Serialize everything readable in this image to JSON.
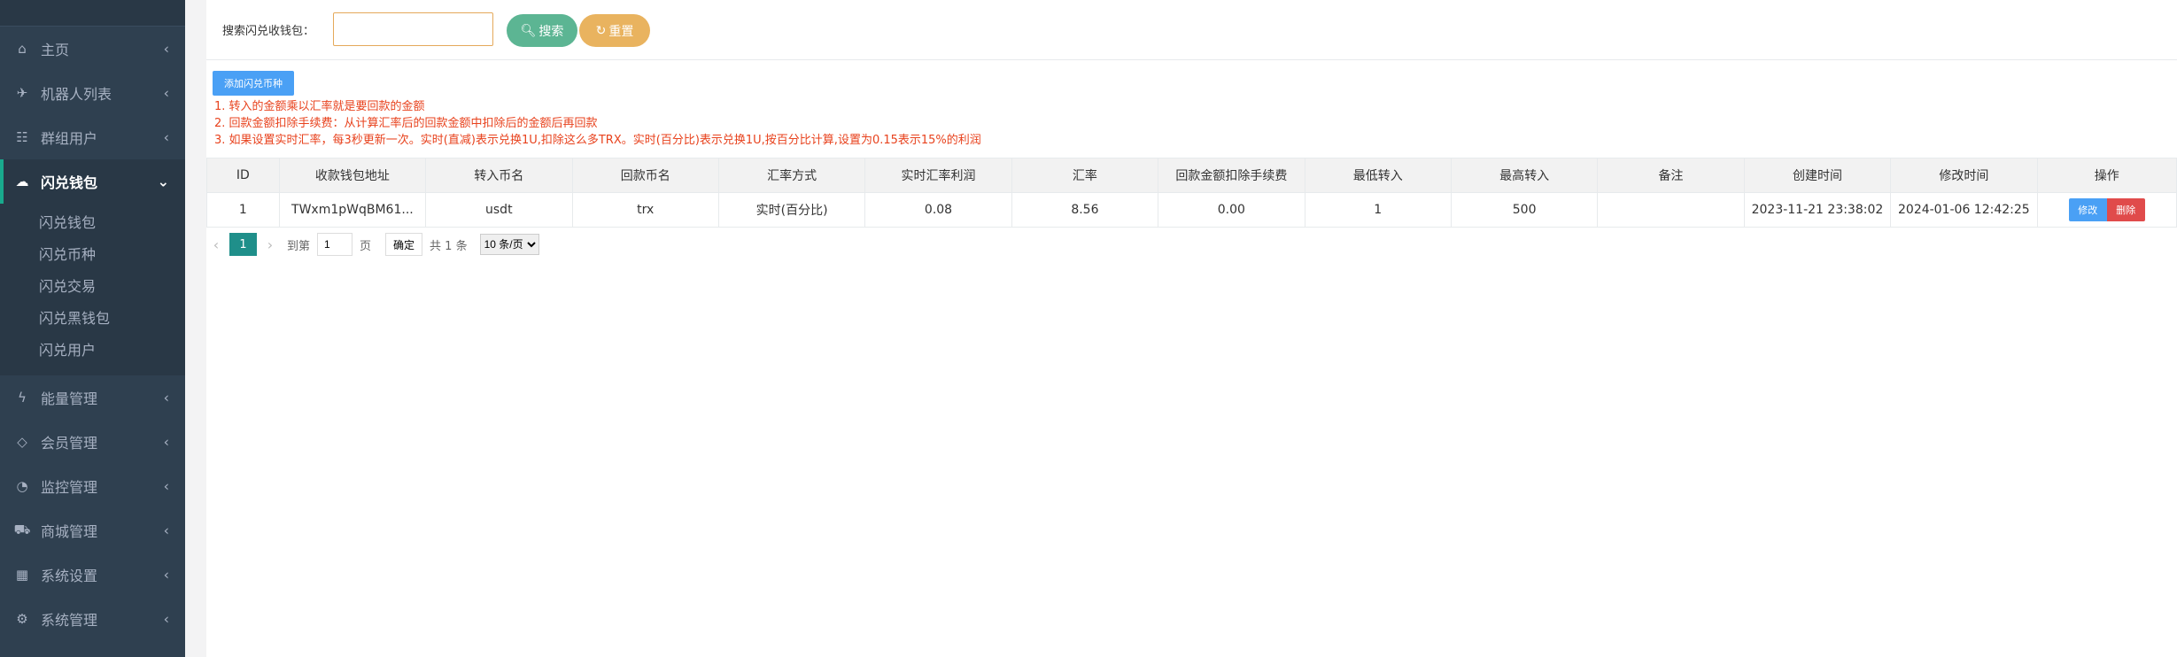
{
  "sidebar": {
    "items": [
      {
        "label": "主页",
        "icon": "home-icon",
        "glyph": "⌂"
      },
      {
        "label": "机器人列表",
        "icon": "plane-icon",
        "glyph": "✈"
      },
      {
        "label": "群组用户",
        "icon": "users-icon",
        "glyph": "☷"
      },
      {
        "label": "闪兑钱包",
        "icon": "cloud-icon",
        "glyph": "☁"
      },
      {
        "label": "能量管理",
        "icon": "bolt-icon",
        "glyph": "ϟ"
      },
      {
        "label": "会员管理",
        "icon": "diamond-icon",
        "glyph": "◇"
      },
      {
        "label": "监控管理",
        "icon": "gauge-icon",
        "glyph": "◔"
      },
      {
        "label": "商城管理",
        "icon": "cart-icon",
        "glyph": "⛟"
      },
      {
        "label": "系统设置",
        "icon": "windows-icon",
        "glyph": "▦"
      },
      {
        "label": "系统管理",
        "icon": "gear-icon",
        "glyph": "⚙"
      }
    ],
    "chevron_collapsed": "‹",
    "chevron_expanded": "⌄",
    "submenu": [
      "闪兑钱包",
      "闪兑币种",
      "闪兑交易",
      "闪兑黑钱包",
      "闪兑用户"
    ]
  },
  "search": {
    "label": "搜索闪兑收钱包：",
    "value": "",
    "search_label": "搜索",
    "reset_label": "重置"
  },
  "toolbar": {
    "add_label": "添加闪兑币种"
  },
  "notes": [
    "1. 转入的金额乘以汇率就是要回款的金额",
    "2. 回款金额扣除手续费：从计算汇率后的回款金额中扣除后的金额后再回款",
    "3. 如果设置实时汇率，每3秒更新一次。实时(直减)表示兑换1U,扣除这么多TRX。实时(百分比)表示兑换1U,按百分比计算,设置为0.15表示15%的利润"
  ],
  "table": {
    "headers": [
      "ID",
      "收款钱包地址",
      "转入币名",
      "回款币名",
      "汇率方式",
      "实时汇率利润",
      "汇率",
      "回款金额扣除手续费",
      "最低转入",
      "最高转入",
      "备注",
      "创建时间",
      "修改时间",
      "操作"
    ],
    "rows": [
      {
        "id": "1",
        "address": "TWxm1pWqBM61...",
        "in_coin": "usdt",
        "out_coin": "trx",
        "rate_mode": "实时(百分比)",
        "rt_profit": "0.08",
        "rate": "8.56",
        "fee": "0.00",
        "min_in": "1",
        "max_in": "500",
        "remark": "",
        "created": "2023-11-21 23:38:02",
        "modified": "2024-01-06 12:42:25",
        "edit_label": "修改",
        "delete_label": "删除"
      }
    ]
  },
  "pager": {
    "prev": "‹",
    "current": "1",
    "next": "›",
    "goto_prefix": "到第",
    "goto_value": "1",
    "goto_suffix": "页",
    "confirm": "确定",
    "total": "共 1 条",
    "page_size": "10 条/页"
  },
  "colors": {
    "sidebar_bg": "#2f4050",
    "search_btn": "#5cb593",
    "reset_btn": "#e9b35f",
    "primary_btn": "#4aa0f5",
    "danger_btn": "#e04b4b",
    "note_text": "#e8421d",
    "pager_active": "#1f8f8a"
  }
}
